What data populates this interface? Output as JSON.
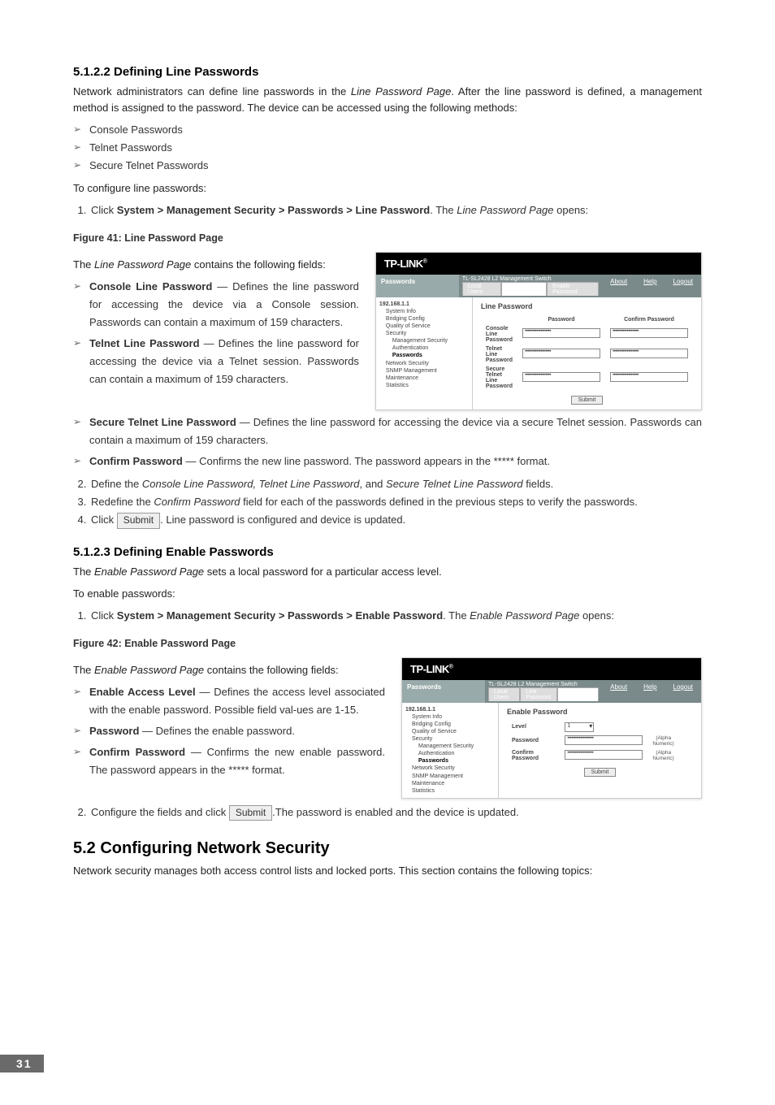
{
  "section_5_1_2_2": {
    "heading": "5.1.2.2  Defining Line Passwords",
    "intro": "Network administrators can define line passwords in the Line Password Page. After the line password is defined, a management method is assigned to the password. The device can be accessed using the following methods:",
    "methods": [
      "Console Passwords",
      "Telnet Passwords",
      "Secure Telnet Passwords"
    ],
    "to_configure": "To configure line passwords:",
    "step1_pre": "Click ",
    "step1_bold": "System > Management Security > Passwords > Line Password",
    "step1_post": ". The Line Password Page opens:",
    "fig41": "Figure 41: Line Password Page",
    "contains": "The Line Password Page contains the following fields:",
    "field_console_label": "Console Line Password",
    "field_console_desc": " — Defines the line password for accessing the device via a Console session. Passwords can contain a maximum of 159 characters.",
    "field_telnet_label": "Telnet Line Password",
    "field_telnet_desc": " — Defines the line password for accessing the device via a Telnet session. Passwords can contain a maximum of 159 characters.",
    "field_secure_label": "Secure Telnet Line Password",
    "field_secure_desc": " — Defines the line password for accessing the device via a secure Telnet session. Passwords can contain a maximum of 159 characters.",
    "field_confirm_label": "Confirm Password",
    "field_confirm_desc": " — Confirms the new line password. The password appears in the ***** format.",
    "step2": "Define the Console Line Password, Telnet Line Password, and Secure Telnet Line Password fields.",
    "step3": "Redefine the Confirm Password field for each of the passwords defined in the previous steps to verify the passwords.",
    "step4_pre": "Click ",
    "submit_btn": "Submit",
    "step4_post": ". Line password is configured and device is updated."
  },
  "section_5_1_2_3": {
    "heading": "5.1.2.3  Defining Enable Passwords",
    "intro": "The Enable Password Page sets a local password for a particular access level.",
    "to_enable": "To enable passwords:",
    "step1_pre": "Click ",
    "step1_bold": "System > Management Security > Passwords > Enable Password",
    "step1_post": ". The Enable Password Page opens:",
    "fig42": "Figure 42: Enable Password Page",
    "contains": "The Enable Password Page contains the following fields:",
    "field_level_label": "Enable Access Level",
    "field_level_desc": " — Defines the access level associated with the enable password. Possible field val-ues are 1-15.",
    "field_pw_label": "Password",
    "field_pw_desc": " — Defines the enable password.",
    "field_confirm_label": "Confirm Password",
    "field_confirm_desc": " — Confirms the new enable password. The password appears in the ***** format.",
    "step2_pre": "Configure the fields and click ",
    "submit_btn": "Submit",
    "step2_post": ".The password is enabled and the device is updated."
  },
  "section_5_2": {
    "heading": "5.2  Configuring Network Security",
    "intro": "Network security manages both access control lists and locked ports. This section contains the following topics:"
  },
  "thumb_common": {
    "brand": "TP-LINK",
    "brand_sup": "®",
    "bannertxt": "TL-SL2428 L2 Management Switch",
    "about": "About",
    "help": "Help",
    "logout": "Logout",
    "panel_title": "Passwords",
    "tabs": [
      "Local Users",
      "Line Password",
      "Enable Password"
    ],
    "tree_root": "192.168.1.1",
    "tree": [
      "System Info",
      "Bridging Config",
      "Quality of Service",
      "Security",
      "Management Security",
      "Authentication",
      "Passwords",
      "Network Security",
      "SNMP Management",
      "Maintenance",
      "Statistics"
    ],
    "submit": "Submit"
  },
  "thumb41": {
    "title": "Line Password",
    "col_pw": "Password",
    "col_confirm": "Confirm Password",
    "rows": [
      "Console Line Password",
      "Telnet Line Password",
      "Secure Telnet Line Password"
    ],
    "masked": "••••••••••••••••••••"
  },
  "thumb42": {
    "title": "Enable Password",
    "row_level": "Level",
    "level_val": "1",
    "row_pw": "Password",
    "row_confirm": "Confirm Password",
    "hint": "(Alpha Numeric)",
    "masked": "••••••••••••••••••••"
  },
  "page_number": "31"
}
